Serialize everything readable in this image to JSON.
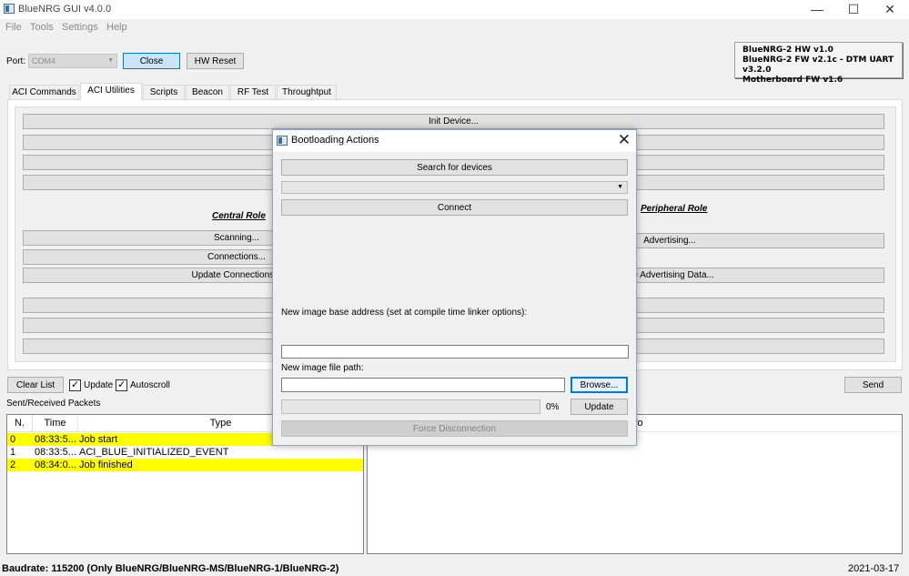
{
  "window": {
    "title": "BlueNRG GUI v4.0.0",
    "minimize": "—",
    "maximize": "☐",
    "close": "✕"
  },
  "menu": [
    "File",
    "Tools",
    "Settings",
    "Help"
  ],
  "port": {
    "label": "Port:",
    "value": "COM4",
    "close_label": "Close",
    "reset_label": "HW Reset"
  },
  "hw_info": [
    "BlueNRG-2 HW v1.0",
    "BlueNRG-2 FW v2.1c - DTM UART v3.2.0",
    "Motherboard FW v1.6"
  ],
  "tabs": [
    "ACI Commands",
    "ACI Utilities",
    "Scripts",
    "Beacon",
    "RF Test",
    "Throughtput"
  ],
  "utilities": {
    "init_device": "Init Device...",
    "central_role": "Central Role",
    "peripheral_role": "Peripheral Role",
    "scanning": "Scanning...",
    "connections": "Connections...",
    "update_connections": "Update Connections...",
    "advertising": "Advertising...",
    "update_advertising": "ate Advertising  Data..."
  },
  "controls": {
    "clear_list": "Clear List",
    "update": "Update",
    "autoscroll": "Autoscroll",
    "send": "Send"
  },
  "packets": {
    "section_label": "Sent/Received Packets",
    "headers": [
      "N.",
      "Time",
      "Type"
    ],
    "rows": [
      {
        "n": "0",
        "time": "08:33:5...",
        "type": "Job start",
        "highlight": true
      },
      {
        "n": "1",
        "time": "08:33:5...",
        "type": "ACI_BLUE_INITIALIZED_EVENT",
        "highlight": false
      },
      {
        "n": "2",
        "time": "08:34:0...",
        "type": "Job finished",
        "highlight": true
      }
    ],
    "info_header": "Info"
  },
  "status": {
    "baudrate": "Baudrate: 115200 (Only BlueNRG/BlueNRG-MS/BlueNRG-1/BlueNRG-2)",
    "date": "2021-03-17"
  },
  "dialog": {
    "title": "Bootloading Actions",
    "search_label": "Search for devices",
    "connect_label": "Connect",
    "base_address_label": "New image base address (set at compile time linker options):",
    "file_path_label": "New image file path:",
    "browse_label": "Browse...",
    "progress_value": 0,
    "progress_text": "0%",
    "update_label": "Update",
    "force_disconnect_label": "Force Disconnection"
  },
  "colors": {
    "highlight": "#ffff00",
    "accent": "#0078d7"
  },
  "icons": [
    "app-icon",
    "close-icon",
    "chevron-down-icon",
    "checkbox-icon"
  ]
}
